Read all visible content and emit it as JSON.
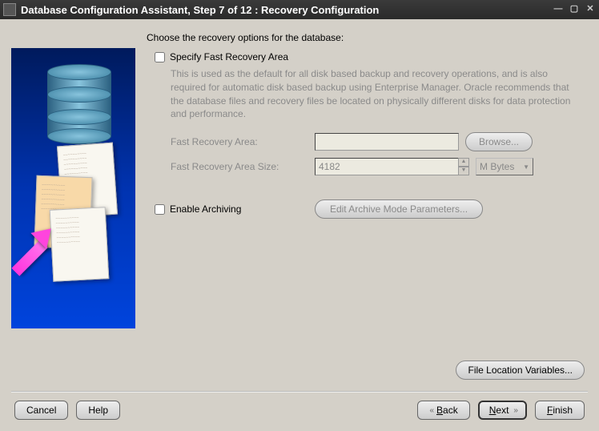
{
  "titlebar": {
    "title": "Database Configuration Assistant, Step 7 of 12 : Recovery Configuration"
  },
  "main": {
    "intro": "Choose the recovery options for the database:",
    "specify": {
      "checkbox_label": "Specify Fast Recovery Area",
      "desc": "This is used as the default for all disk based backup and recovery operations, and is also required for automatic disk based backup using Enterprise Manager. Oracle recommends that the database files and recovery files be located on physically different disks for data protection and performance.",
      "area_label": "Fast Recovery Area:",
      "area_value": "",
      "browse_label": "Browse...",
      "size_label": "Fast Recovery Area Size:",
      "size_value": "4182",
      "unit_value": "M Bytes"
    },
    "archive": {
      "checkbox_label": "Enable Archiving",
      "edit_label": "Edit Archive Mode Parameters..."
    },
    "file_loc_label": "File Location Variables..."
  },
  "buttons": {
    "cancel": "Cancel",
    "help": "Help",
    "back": "Back",
    "next": "Next",
    "finish": "Finish"
  }
}
